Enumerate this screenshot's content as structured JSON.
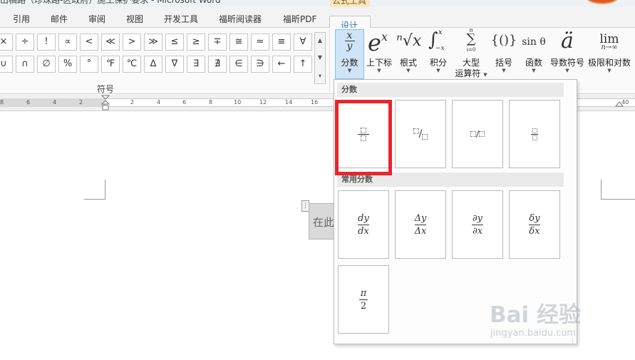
{
  "window": {
    "title": "出稿路（珍珠路-区政府）施工保护要求 - Microsoft Word",
    "context_tab_group": "公式工具"
  },
  "tabs": [
    {
      "label": "引用"
    },
    {
      "label": "邮件"
    },
    {
      "label": "审阅"
    },
    {
      "label": "视图"
    },
    {
      "label": "开发工具"
    },
    {
      "label": "福昕阅读器"
    },
    {
      "label": "福昕PDF"
    }
  ],
  "active_tab": "设计",
  "symbols": {
    "group_label": "符号",
    "row1": [
      "×",
      "÷",
      "!",
      "∝",
      "<",
      "≪",
      ">",
      "≫",
      "≤",
      "≥",
      "∓",
      "≅",
      "≈",
      "≡",
      "∀"
    ],
    "row2": [
      "∪",
      "∩",
      "∅",
      "%",
      "°",
      "℉",
      "℃",
      "∆",
      "∇",
      "∃",
      "∄",
      "∈",
      "∋",
      "←",
      "↑"
    ]
  },
  "structures": [
    {
      "label": "分数",
      "glyph_top": "x",
      "glyph_bottom": "y"
    },
    {
      "label": "上下标",
      "glyph": "e",
      "glyph_sup": "x"
    },
    {
      "label": "根式",
      "glyph": "ⁿ√x"
    },
    {
      "label": "积分",
      "glyph": "∫",
      "glyph_sup": "x",
      "glyph_sub": "−x"
    },
    {
      "label": "大型",
      "label2": "运算符",
      "glyph": "∑",
      "glyph_sup": "n",
      "glyph_sub": "i=0"
    },
    {
      "label": "括号",
      "glyph": "{()}"
    },
    {
      "label": "函数",
      "glyph": "sin θ"
    },
    {
      "label": "导数符号",
      "glyph": "ä"
    },
    {
      "label": "极限和对数",
      "glyph": "lim",
      "glyph_sub": "n→∞"
    }
  ],
  "ruler": {
    "numbers": [
      "8",
      "6",
      "4",
      "2",
      "2",
      "4",
      "6",
      "8",
      "10",
      "12",
      "14",
      "16",
      "40"
    ]
  },
  "document": {
    "equation_placeholder": "在此"
  },
  "fraction_gallery": {
    "section1_title": "分数",
    "section2_title": "常用分数",
    "common": [
      {
        "num": "dy",
        "den": "dx"
      },
      {
        "num": "Δy",
        "den": "Δx"
      },
      {
        "num": "∂y",
        "den": "∂x"
      },
      {
        "num": "δy",
        "den": "δx"
      },
      {
        "num": "π",
        "den": "2"
      }
    ],
    "skewed_slash": "/",
    "linear_slash": "/"
  },
  "watermark": {
    "brand": "Bai 经验",
    "url": "jingyan.baidu.com"
  },
  "colors": {
    "highlight": "#e8262c",
    "active_tab_text": "#2d6bbf",
    "selected_button": "#cfe4f7"
  }
}
